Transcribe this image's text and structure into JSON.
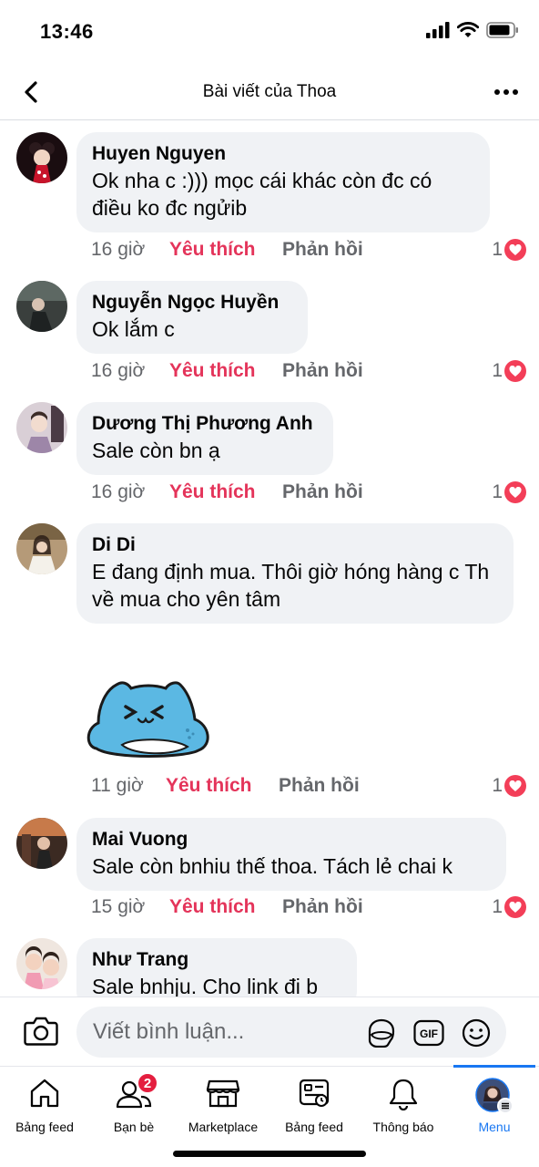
{
  "status_bar": {
    "time": "13:46"
  },
  "header": {
    "title": "Bài viết của Thoa"
  },
  "comments": [
    {
      "author": "Huyen Nguyen",
      "text": "Ok nha c :))) mọc cái khác còn đc có điều ko đc ngửib",
      "time": "16 giờ",
      "like_label": "Yêu thích",
      "reply_label": "Phản hồi",
      "reactions": "1"
    },
    {
      "author": "Nguyễn Ngọc Huyền",
      "text": "Ok lắm c",
      "time": "16 giờ",
      "like_label": "Yêu thích",
      "reply_label": "Phản hồi",
      "reactions": "1"
    },
    {
      "author": "Dương Thị Phương Anh",
      "text": "Sale còn bn ạ",
      "time": "16 giờ",
      "like_label": "Yêu thích",
      "reply_label": "Phản hồi",
      "reactions": "1"
    },
    {
      "author": "Di Di",
      "text": "E đang định mua. Thôi giờ hóng hàng c Th về mua cho yên tâm",
      "time": "11 giờ",
      "like_label": "Yêu thích",
      "reply_label": "Phản hồi",
      "reactions": "1"
    },
    {
      "author": "Mai Vuong",
      "text": "Sale còn bnhiu thế thoa. Tách lẻ chai k",
      "time": "15 giờ",
      "like_label": "Yêu thích",
      "reply_label": "Phản hồi",
      "reactions": "1"
    },
    {
      "author": "Như Trang",
      "text": "Sale bnhju. Cho link đi b"
    }
  ],
  "composer": {
    "placeholder": "Viết bình luận...",
    "gif_label": "GIF"
  },
  "tabbar": {
    "items": [
      {
        "label": "Bảng feed"
      },
      {
        "label": "Bạn bè",
        "badge": "2"
      },
      {
        "label": "Marketplace"
      },
      {
        "label": "Bảng feed"
      },
      {
        "label": "Thông báo"
      },
      {
        "label": "Menu"
      }
    ]
  },
  "colors": {
    "like": "#e4345a",
    "reaction_heart": "#f33e58",
    "accent": "#1877f2",
    "bubble": "#f0f2f5",
    "badge": "#e41e3f"
  },
  "icons": [
    "back-arrow-icon",
    "more-icon",
    "heart-icon",
    "camera-icon",
    "sticker-icon",
    "gif-icon",
    "emoji-icon",
    "home-icon",
    "friends-icon",
    "marketplace-icon",
    "feed-icon",
    "bell-icon",
    "menu-avatar-icon"
  ]
}
